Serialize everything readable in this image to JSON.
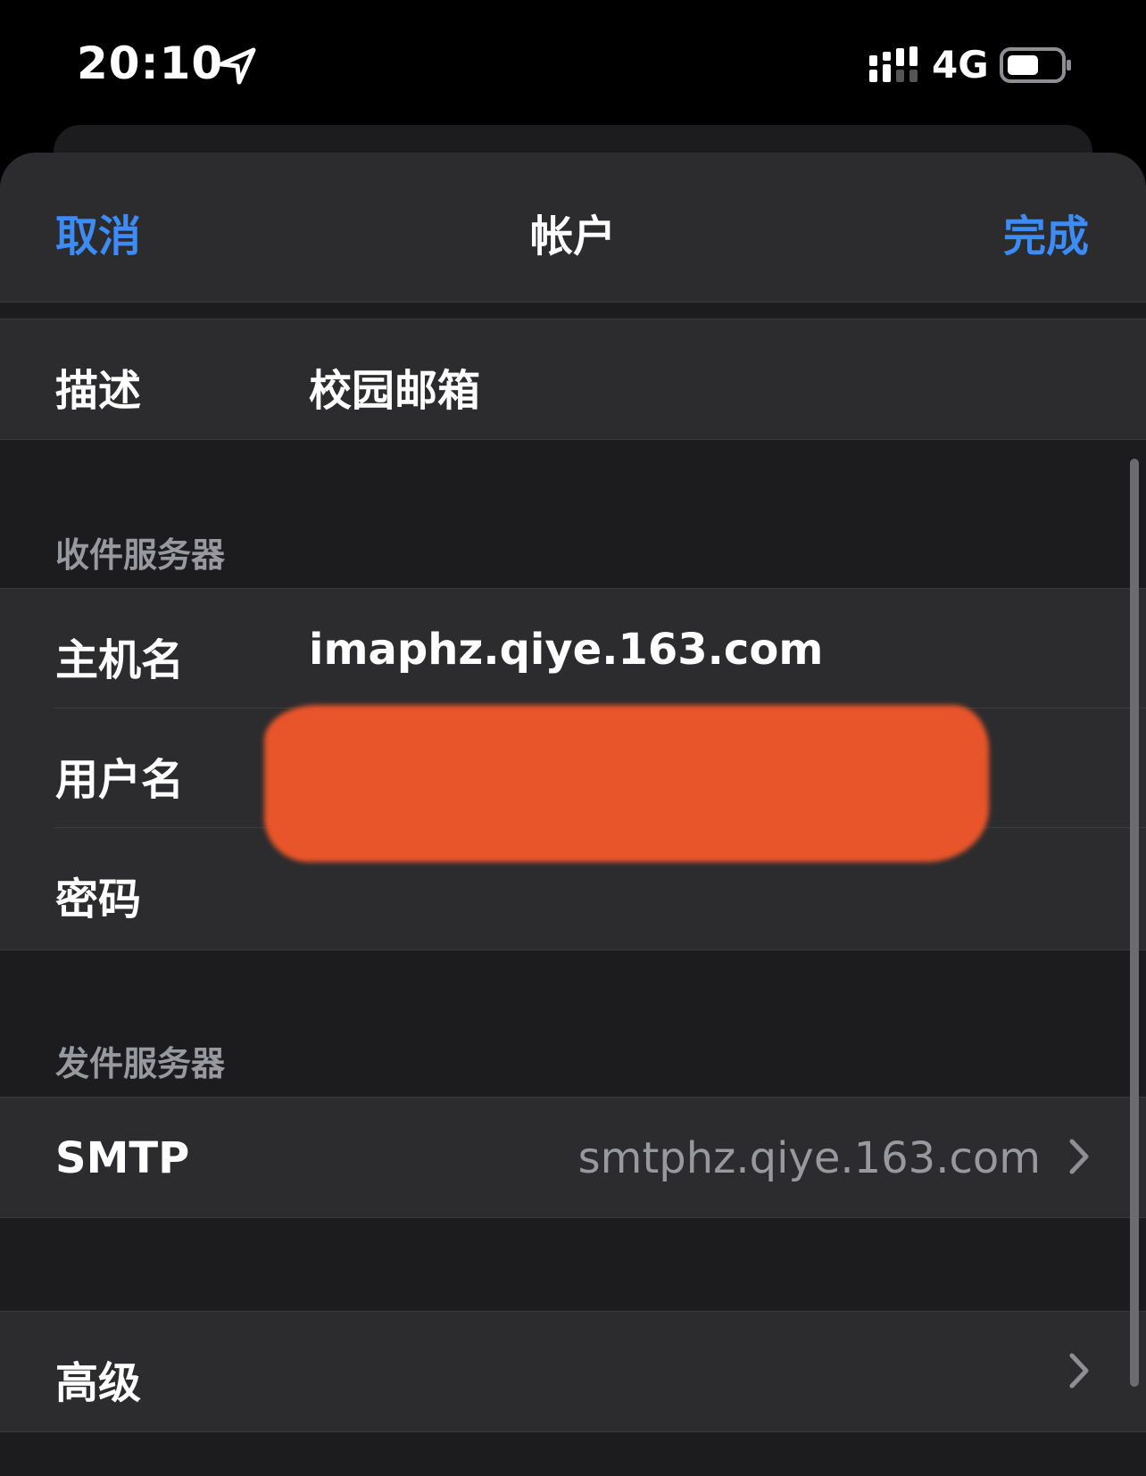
{
  "status_bar": {
    "time": "20:10",
    "network": "4G",
    "icons": [
      "location-arrow-icon",
      "cellular-signal-icon",
      "battery-icon"
    ]
  },
  "nav": {
    "cancel_label": "取消",
    "title": "帐户",
    "done_label": "完成"
  },
  "account": {
    "description_label": "描述",
    "description_value": "校园邮箱"
  },
  "incoming": {
    "header": "收件服务器",
    "hostname_label": "主机名",
    "hostname_value": "imaphz.qiye.163.com",
    "username_label": "用户名",
    "password_label": "密码"
  },
  "outgoing": {
    "header": "发件服务器",
    "smtp_label": "SMTP",
    "smtp_value": "smtphz.qiye.163.com"
  },
  "advanced": {
    "label": "高级"
  },
  "colors": {
    "accent": "#3d8bf5",
    "redaction": "#e9552a",
    "background": "#1c1c1e",
    "cell": "#2c2c2e"
  }
}
